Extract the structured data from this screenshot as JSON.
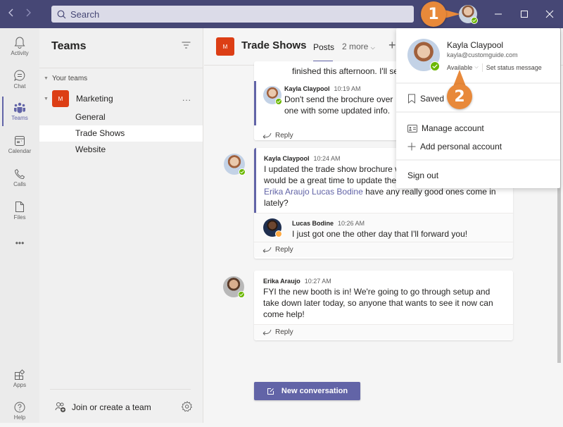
{
  "titlebar": {
    "search_placeholder": "Search",
    "back_icon": "chevron-left-icon",
    "forward_icon": "chevron-right-icon",
    "window_controls": [
      "minimize",
      "maximize",
      "close"
    ]
  },
  "rail": {
    "items": [
      {
        "label": "Activity",
        "icon": "bell-icon"
      },
      {
        "label": "Chat",
        "icon": "chat-icon"
      },
      {
        "label": "Teams",
        "icon": "teams-icon",
        "active": true
      },
      {
        "label": "Calendar",
        "icon": "calendar-icon"
      },
      {
        "label": "Calls",
        "icon": "phone-icon"
      },
      {
        "label": "Files",
        "icon": "file-icon"
      },
      {
        "label": "...",
        "icon": "more-icon"
      }
    ],
    "bottom": [
      {
        "label": "Apps",
        "icon": "apps-icon"
      },
      {
        "label": "Help",
        "icon": "help-icon"
      }
    ]
  },
  "teams_panel": {
    "title": "Teams",
    "section_label": "Your teams",
    "team": {
      "name": "Marketing",
      "initial": "M",
      "more": "..."
    },
    "channels": [
      {
        "name": "General"
      },
      {
        "name": "Trade Shows",
        "active": true
      },
      {
        "name": "Website"
      }
    ],
    "join_label": "Join or create a team"
  },
  "channel": {
    "initial": "M",
    "title": "Trade Shows",
    "tabs": {
      "posts": "Posts",
      "more": "2 more"
    },
    "add": "+"
  },
  "threads": [
    {
      "partial_text": "finished this afternoon. I'll ser",
      "reply": {
        "author": "Kayla Claypool",
        "time": "10:19 AM",
        "text_line1": "Don't send the brochure over",
        "text_line2": "one with some updated info."
      },
      "reply_label": "Reply"
    },
    {
      "author": "Kayla Claypool",
      "time": "10:24 AM",
      "text_line1": "I updated the trade show brochure w",
      "text_line2": "would be a great time to update the",
      "mention1": "Erika Araujo",
      "mention2": "Lucas Bodine",
      "text_line3": " have any really good ones come in",
      "text_line4": "lately?",
      "reply": {
        "author": "Lucas Bodine",
        "time": "10:26 AM",
        "text": "I just got one the other day that I'll forward you!"
      },
      "reply_label": "Reply"
    },
    {
      "author": "Erika Araujo",
      "time": "10:27 AM",
      "text": "FYI the new booth is in! We're going to go through setup and take down later today, so anyone that wants to see it now can come help!",
      "reply_label": "Reply"
    }
  ],
  "new_conversation_label": "New conversation",
  "profile_menu": {
    "name": "Kayla Claypool",
    "email": "kayla@customguide.com",
    "status": "Available",
    "set_status": "Set status message",
    "saved": "Saved",
    "manage_account": "Manage account",
    "add_personal_account": "Add personal account",
    "sign_out": "Sign out"
  },
  "callouts": [
    "1",
    "2"
  ],
  "colors": {
    "accent": "#6264a7",
    "titlebar": "#464775",
    "team_logo": "#dc3e15",
    "available": "#6bb700",
    "away": "#ffaa44",
    "callout": "#e8893a"
  }
}
